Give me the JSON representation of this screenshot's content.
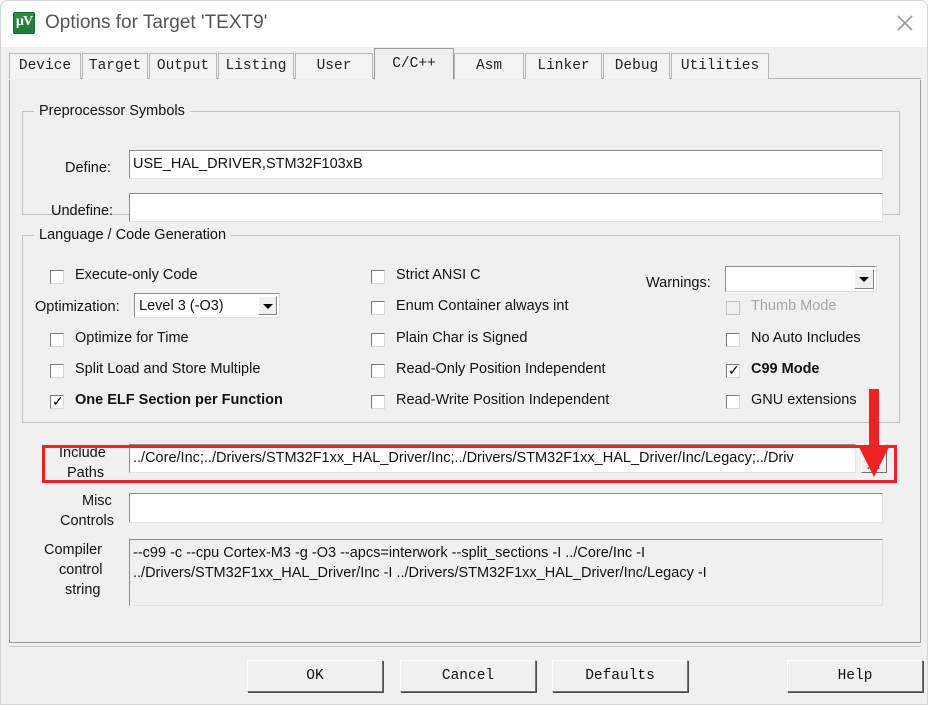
{
  "window": {
    "title": "Options for Target 'TEXT9'",
    "icon": "keil-uvision-icon",
    "close_label": "✕"
  },
  "tabs": [
    {
      "label": "Device",
      "active": false
    },
    {
      "label": "Target",
      "active": false
    },
    {
      "label": "Output",
      "active": false
    },
    {
      "label": "Listing",
      "active": false
    },
    {
      "label": "User",
      "active": false
    },
    {
      "label": "C/C++",
      "active": true
    },
    {
      "label": "Asm",
      "active": false
    },
    {
      "label": "Linker",
      "active": false
    },
    {
      "label": "Debug",
      "active": false
    },
    {
      "label": "Utilities",
      "active": false
    }
  ],
  "preprocessor": {
    "legend": "Preprocessor Symbols",
    "define_label": "Define:",
    "define_value": "USE_HAL_DRIVER,STM32F103xB",
    "undefine_label": "Undefine:",
    "undefine_value": ""
  },
  "language": {
    "legend": "Language / Code Generation",
    "col1": [
      {
        "label": "Execute-only Code",
        "checked": false,
        "disabled": false
      },
      {
        "label": "Optimize for Time",
        "checked": false,
        "disabled": false
      },
      {
        "label": "Split Load and Store Multiple",
        "checked": false,
        "disabled": false
      },
      {
        "label": "One ELF Section per Function",
        "checked": true,
        "disabled": false
      }
    ],
    "col2": [
      {
        "label": "Strict ANSI C",
        "checked": false,
        "disabled": false
      },
      {
        "label": "Enum Container always int",
        "checked": false,
        "disabled": false
      },
      {
        "label": "Plain Char is Signed",
        "checked": false,
        "disabled": false
      },
      {
        "label": "Read-Only Position Independent",
        "checked": false,
        "disabled": false
      },
      {
        "label": "Read-Write Position Independent",
        "checked": false,
        "disabled": false
      }
    ],
    "col3": [
      {
        "label": "Thumb Mode",
        "checked": false,
        "disabled": true
      },
      {
        "label": "No Auto Includes",
        "checked": false,
        "disabled": false
      },
      {
        "label": "C99 Mode",
        "checked": true,
        "disabled": false
      },
      {
        "label": "GNU extensions",
        "checked": false,
        "disabled": false
      }
    ],
    "optimization_label": "Optimization:",
    "optimization_value": "Level 3 (-O3)",
    "warnings_label": "Warnings:",
    "warnings_value": ""
  },
  "include_paths": {
    "label_line1": "Include",
    "label_line2": "Paths",
    "value": "../Core/Inc;../Drivers/STM32F1xx_HAL_Driver/Inc;../Drivers/STM32F1xx_HAL_Driver/Inc/Legacy;../Driv",
    "browse_label": "..."
  },
  "misc_controls": {
    "label_line1": "Misc",
    "label_line2": "Controls",
    "value": ""
  },
  "compiler_control": {
    "label_line1": "Compiler",
    "label_line2": "control",
    "label_line3": "string",
    "line1": "--c99 -c --cpu Cortex-M3 -g -O3 --apcs=interwork --split_sections -I ../Core/Inc -I",
    "line2": "../Drivers/STM32F1xx_HAL_Driver/Inc -I ../Drivers/STM32F1xx_HAL_Driver/Inc/Legacy -I"
  },
  "buttons": [
    {
      "label": "OK"
    },
    {
      "label": "Cancel"
    },
    {
      "label": "Defaults"
    },
    {
      "label": "Help"
    }
  ],
  "annotation": {
    "highlight_color": "#ee2222",
    "arrow_color": "#ee2222"
  }
}
